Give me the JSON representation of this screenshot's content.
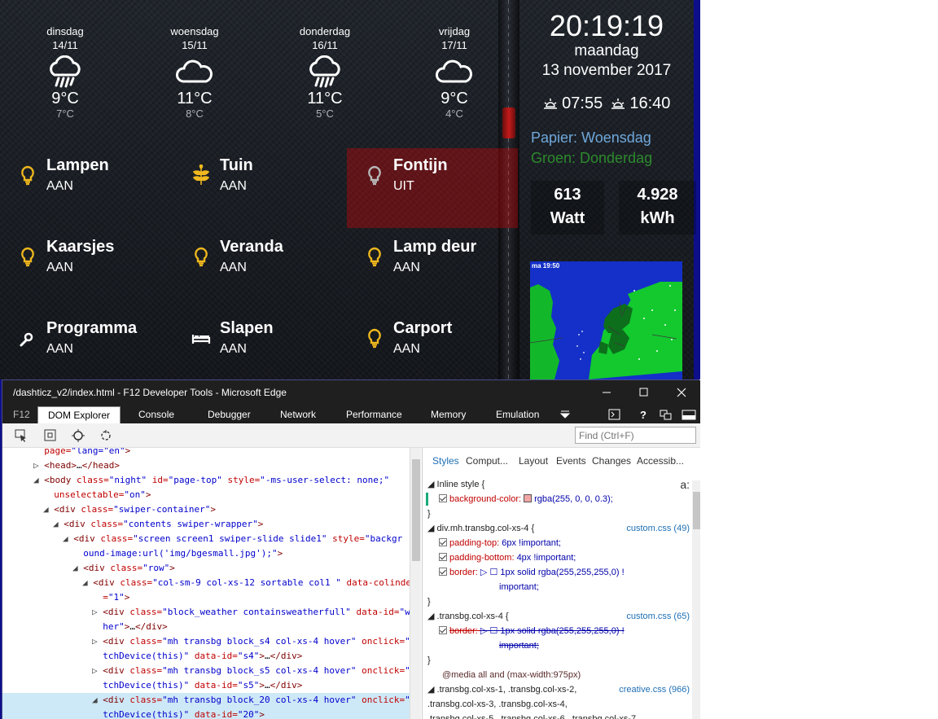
{
  "forecast": [
    {
      "day": "dinsdag",
      "date": "14/11",
      "temp": "9°C",
      "min": "7°C",
      "icon": "rain-cloud-icon"
    },
    {
      "day": "woensdag",
      "date": "15/11",
      "temp": "11°C",
      "min": "8°C",
      "icon": "cloud-icon"
    },
    {
      "day": "donderdag",
      "date": "16/11",
      "temp": "11°C",
      "min": "5°C",
      "icon": "rain-cloud-icon"
    },
    {
      "day": "vrijdag",
      "date": "17/11",
      "temp": "9°C",
      "min": "4°C",
      "icon": "cloud-icon"
    }
  ],
  "tiles": [
    {
      "name": "Lampen",
      "state": "AAN",
      "icon": "bulb-icon",
      "on": true
    },
    {
      "name": "Tuin",
      "state": "AAN",
      "icon": "plant-icon",
      "on": true
    },
    {
      "name": "Fontijn",
      "state": "UIT",
      "icon": "bulb-icon",
      "on": false
    },
    {
      "name": "Kaarsjes",
      "state": "AAN",
      "icon": "bulb-icon",
      "on": true
    },
    {
      "name": "Veranda",
      "state": "AAN",
      "icon": "bulb-icon",
      "on": true
    },
    {
      "name": "Lamp deur",
      "state": "AAN",
      "icon": "bulb-icon",
      "on": true
    },
    {
      "name": "Programma",
      "state": "AAN",
      "icon": "gear-icon",
      "on": true
    },
    {
      "name": "Slapen",
      "state": "AAN",
      "icon": "bed-icon",
      "on": true
    },
    {
      "name": "Carport",
      "state": "AAN",
      "icon": "bulb-icon",
      "on": true
    }
  ],
  "clock": {
    "time": "20:19:19",
    "weekday": "maandag",
    "date": "13 november 2017"
  },
  "sun": {
    "rise": "07:55",
    "set": "16:40"
  },
  "trash": {
    "paper": "Papier: Woensdag",
    "green": "Groen: Donderdag"
  },
  "energy": {
    "power_value": "613",
    "power_unit": "Watt",
    "total_value": "4.928",
    "total_unit": "kWh"
  },
  "radar": {
    "stamp": "ma 19:50"
  },
  "colors": {
    "accent_bulb": "#f0b81e",
    "off_tile": "rgba(255,0,0,0.3)",
    "paper": "#6fa8dc",
    "green": "#2d8a2d"
  },
  "devtools": {
    "title": "/dashticz_v2/index.html - F12 Developer Tools - Microsoft Edge",
    "f12": "F12",
    "tabs": [
      "DOM Explorer",
      "Console",
      "Debugger",
      "Network",
      "Performance",
      "Memory",
      "Emulation"
    ],
    "find_placeholder": "Find (Ctrl+F)",
    "style_tabs": [
      "Styles",
      "Comput...",
      "Layout",
      "Events",
      "Changes",
      "Accessib..."
    ],
    "dom_lines": [
      {
        "indent": 3,
        "arrow": "",
        "html": "<span class='an'>page=</span><span class='av'>\"lang=\"en\"</span><span class='tn'>&gt;</span>"
      },
      {
        "indent": 3,
        "arrow": "▷",
        "html": "<span class='tn'>&lt;head&gt;</span>…<span class='tn'>&lt;/head&gt;</span>"
      },
      {
        "indent": 3,
        "arrow": "◢",
        "html": "<span class='tn'>&lt;body </span><span class='an'>class=</span><span class='av'>\"night\"</span><span class='an'> id=</span><span class='av'>\"page-top\"</span><span class='an'> style=</span><span class='av'>\"-ms-user-select: none;\"</span>"
      },
      {
        "indent": 4,
        "arrow": "",
        "html": "<span class='an'>unselectable=</span><span class='av'>\"on\"</span><span class='tn'>&gt;</span>"
      },
      {
        "indent": 4,
        "arrow": "◢",
        "html": "<span class='tn'>&lt;div </span><span class='an'>class=</span><span class='av'>\"swiper-container\"</span><span class='tn'>&gt;</span>"
      },
      {
        "indent": 5,
        "arrow": "◢",
        "html": "<span class='tn'>&lt;div </span><span class='an'>class=</span><span class='av'>\"contents swiper-wrapper\"</span><span class='tn'>&gt;</span>"
      },
      {
        "indent": 6,
        "arrow": "◢",
        "html": "<span class='tn'>&lt;div </span><span class='an'>class=</span><span class='av'>\"screen screen1 swiper-slide slide1\"</span><span class='an'> style=</span><span class='av'>\"backgr</span>"
      },
      {
        "indent": 7,
        "arrow": "",
        "html": "<span class='av'>ound-image:url('img/bgesmall.jpg');\"</span><span class='tn'>&gt;</span>"
      },
      {
        "indent": 7,
        "arrow": "◢",
        "html": "<span class='tn'>&lt;div </span><span class='an'>class=</span><span class='av'>\"row\"</span><span class='tn'>&gt;</span>"
      },
      {
        "indent": 8,
        "arrow": "◢",
        "html": "<span class='tn'>&lt;div </span><span class='an'>class=</span><span class='av'>\"col-sm-9 col-xs-12 sortable col1 \"</span><span class='an'> data-colinde</span>"
      },
      {
        "indent": 9,
        "arrow": "",
        "html": "<span class='an'>=</span><span class='av'>\"1\"</span><span class='tn'>&gt;</span>"
      },
      {
        "indent": 9,
        "arrow": "▷",
        "html": "<span class='tn'>&lt;div </span><span class='an'>class=</span><span class='av'>\"block_weather containsweatherfull\"</span><span class='an'> data-id=</span><span class='av'>\"w</span>"
      },
      {
        "indent": 9,
        "arrow": "",
        "html": "<span class='av'>her\"</span><span class='tn'>&gt;</span>…<span class='tn'>&lt;/div&gt;</span>"
      },
      {
        "indent": 9,
        "arrow": "▷",
        "html": "<span class='tn'>&lt;div </span><span class='an'>class=</span><span class='av'>\"mh transbg block_s4 col-xs-4 hover\"</span><span class='an'> onclick=</span><span class='av'>\"</span>"
      },
      {
        "indent": 9,
        "arrow": "",
        "html": "<span class='av'>tchDevice(this)\"</span><span class='an'> data-id=</span><span class='av'>\"s4\"</span><span class='tn'>&gt;</span>…<span class='tn'>&lt;/div&gt;</span>"
      },
      {
        "indent": 9,
        "arrow": "▷",
        "html": "<span class='tn'>&lt;div </span><span class='an'>class=</span><span class='av'>\"mh transbg block_s5 col-xs-4 hover\"</span><span class='an'> onclick=</span><span class='av'>\"</span>"
      },
      {
        "indent": 9,
        "arrow": "",
        "html": "<span class='av'>tchDevice(this)\"</span><span class='an'> data-id=</span><span class='av'>\"s5\"</span><span class='tn'>&gt;</span>…<span class='tn'>&lt;/div&gt;</span>"
      },
      {
        "indent": 9,
        "arrow": "◢",
        "html": "<span class='tn'>&lt;div </span><span class='an'>class=</span><span class='av'>\"mh transbg block_20 col-xs-4 hover\"</span><span class='an'> onclick=</span><span class='av'>\"</span>"
      },
      {
        "indent": 9,
        "arrow": "",
        "html": "<span class='av'>tchDevice(this)\"</span><span class='an'> data-id=</span><span class='av'>\"20\"</span><span class='tn'>&gt;</span>"
      }
    ],
    "style_lines": [
      {
        "kind": "head",
        "text": "◢ Inline style  {",
        "extra": "a:"
      },
      {
        "kind": "prop",
        "on": true,
        "name": "background-color:",
        "value": "rgba(255, 0, 0, 0.3);",
        "swatch": "#f3a6a6",
        "green": true
      },
      {
        "kind": "close",
        "text": "}"
      },
      {
        "kind": "rule",
        "text": "◢ div.mh.transbg.col-xs-4  {",
        "src": "custom.css (49)"
      },
      {
        "kind": "prop",
        "on": true,
        "name": "padding-top:",
        "value": "6px !important;"
      },
      {
        "kind": "prop",
        "on": true,
        "name": "padding-bottom:",
        "value": "4px !important;"
      },
      {
        "kind": "prop",
        "on": true,
        "name": "border:",
        "value": "▷ ☐ 1px solid rgba(255,255,255,0) !"
      },
      {
        "kind": "cont",
        "text": "important;"
      },
      {
        "kind": "close",
        "text": "}"
      },
      {
        "kind": "rule",
        "text": "◢ .transbg.col-xs-4  {",
        "src": "custom.css (65)"
      },
      {
        "kind": "prop",
        "on": true,
        "strike": true,
        "name": "border:",
        "value": "▷ ☐ 1px solid rgba(255,255,255,0) !"
      },
      {
        "kind": "cont",
        "strike": true,
        "text": "important;"
      },
      {
        "kind": "close",
        "text": "}"
      },
      {
        "kind": "media",
        "text": "@media all and (max-width:975px)"
      },
      {
        "kind": "rule",
        "text": "◢ .transbg.col-xs-1, .transbg.col-xs-2,",
        "src": "creative.css (966)"
      },
      {
        "kind": "plain",
        "text": ".transbg.col-xs-3, .transbg.col-xs-4,"
      },
      {
        "kind": "plain",
        "text": ".transbg.col-xs-5, .transbg.col-xs-6, .transbg.col-xs-7,"
      }
    ]
  }
}
